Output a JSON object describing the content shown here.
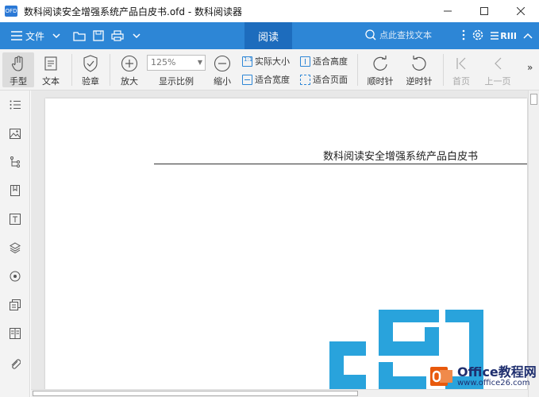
{
  "window": {
    "app_logo": "OFD",
    "title": "数科阅读安全增强系统产品白皮书.ofd - 数科阅读器"
  },
  "menubar": {
    "file_label": "文件",
    "active_tab": "阅读",
    "search_placeholder": "点此查找文本",
    "brand_mark": "RIII"
  },
  "toolbar": {
    "hand": "手型",
    "text": "文本",
    "verify": "验章",
    "zoom_in": "放大",
    "zoom_value": "125%",
    "zoom_label": "显示比例",
    "zoom_out": "缩小",
    "actual_size": "实际大小",
    "fit_width": "适合宽度",
    "fit_height": "适合高度",
    "fit_page": "适合页面",
    "rotate_cw": "顺时针",
    "rotate_ccw": "逆时针",
    "first_page": "首页",
    "prev_page": "上一页",
    "more": "»"
  },
  "document": {
    "heading": "数科阅读安全增强系统产品白皮书"
  },
  "watermark": {
    "line1": "Office教程网",
    "line2": "www.office26.com"
  },
  "colors": {
    "accent": "#2d86d6",
    "active_tab": "#1d6cbd",
    "logo_blue": "#29a3dc",
    "watermark_orange": "#e8590c"
  }
}
